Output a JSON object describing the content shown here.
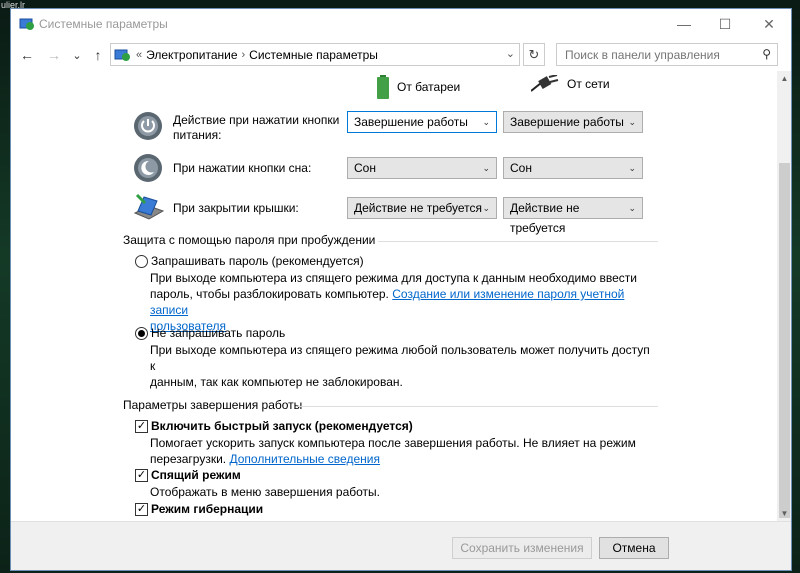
{
  "desktop": {
    "caption": "ulier.lr"
  },
  "window": {
    "title": "Системные параметры",
    "controls": {
      "minimize": "—",
      "maximize": "☐",
      "close": "✕"
    }
  },
  "nav": {
    "back": "←",
    "forward": "→",
    "history": "⌄",
    "up": "↑",
    "breadcrumb": {
      "root": "«",
      "items": [
        "Электропитание",
        "Системные параметры"
      ]
    },
    "refresh": "↻",
    "search_placeholder": "Поиск в панели управления",
    "search_icon": "⚲"
  },
  "power": {
    "columns": {
      "battery": "От батареи",
      "plugged": "От сети"
    },
    "rows": [
      {
        "label": "Действие при нажатии кнопки питания:",
        "battery": "Завершение работы",
        "plugged": "Завершение работы",
        "icon": "power-button-icon"
      },
      {
        "label": "При нажатии кнопки сна:",
        "battery": "Сон",
        "plugged": "Сон",
        "icon": "sleep-button-icon"
      },
      {
        "label": "При закрытии крышки:",
        "battery": "Действие не требуется",
        "plugged": "Действие не требуется",
        "icon": "laptop-lid-icon"
      }
    ]
  },
  "password": {
    "header": "Защита с помощью пароля при пробуждении",
    "opt1": {
      "label": "Запрашивать пароль (рекомендуется)",
      "desc_line1": "При выходе компьютера из спящего режима для доступа к данным необходимо ввести",
      "desc_line2": "пароль, чтобы разблокировать компьютер.",
      "link_part1": "Создание или изменение пароля учетной записи",
      "link_part2": "пользователя",
      "checked": false
    },
    "opt2": {
      "label": "Не запрашивать пароль",
      "desc_line1": "При выходе компьютера из спящего режима любой пользователь может получить доступ к",
      "desc_line2": "данным, так как компьютер не заблокирован.",
      "checked": true
    }
  },
  "shutdown": {
    "header": "Параметры завершения работы",
    "fast": {
      "label": "Включить быстрый запуск (рекомендуется)",
      "desc_line1": "Помогает ускорить запуск компьютера после завершения работы. Не влияет на режим",
      "desc_line2": "перезагрузки.",
      "link": "Дополнительные сведения",
      "checked": true
    },
    "sleep": {
      "label": "Спящий режим",
      "desc": "Отображать в меню завершения работы.",
      "checked": true
    },
    "hibernate": {
      "label": "Режим гибернации",
      "checked": true
    }
  },
  "buttons": {
    "save": "Сохранить изменения",
    "cancel": "Отмена"
  },
  "glyphs": {
    "dropdown": "⌄",
    "check": "✓",
    "scroll_up": "▲",
    "scroll_down": "▼"
  }
}
